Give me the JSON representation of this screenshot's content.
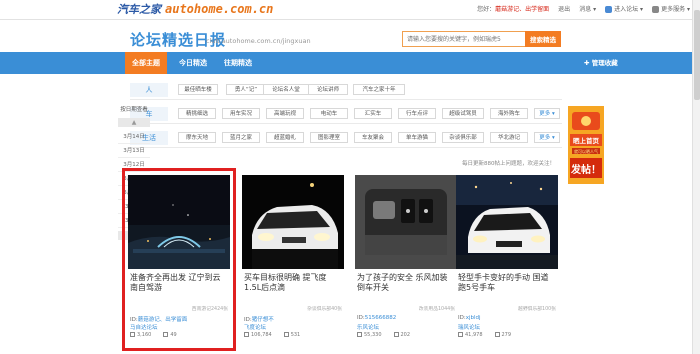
{
  "topbar": {
    "logo_cn": "汽车之家",
    "logo_domain": "autohome.com.cn",
    "greeting": "您好：",
    "user": "蘑菇游记、出学留面",
    "logout": "退出",
    "messages": "消息",
    "enter_forum": "进入论坛",
    "more_apps": "更多服务"
  },
  "header": {
    "title": "论坛精选日报",
    "subtitle": "club.autohome.com.cn/jingxuan",
    "search_placeholder": "请输入您要搜的关键字，例如瑞虎5",
    "search_button": "搜索精选"
  },
  "nav": {
    "tabs": [
      "全部主题",
      "今日精选",
      "往期精选"
    ],
    "active_index": 0,
    "favorites": "管理收藏"
  },
  "categories": [
    {
      "name": "人",
      "tags": [
        "最佳晒车楼",
        "勇人“记”",
        "论坛名人堂",
        "论坛讲师",
        "汽车之家十年"
      ]
    },
    {
      "name": "车",
      "tags": [
        "精挑细选",
        "用车实况",
        "高端玩视",
        "电动车",
        "汇实车",
        "行车点评",
        "超级试驾员",
        "海外购车",
        "更多"
      ]
    },
    {
      "name": "生活",
      "tags": [
        "摩东天地",
        "蓝月之家",
        "超蓝婚礼",
        "图影理室",
        "车友聚会",
        "单车游猫",
        "杂谈俱乐部",
        "华北游记",
        "更多"
      ]
    }
  ],
  "dates": {
    "header": "按日期查看",
    "items": [
      "3月14日",
      "3月13日",
      "3月12日",
      "3月11日",
      "3月10日",
      "3月9日",
      "3月8日"
    ]
  },
  "notice": "每日更新880帖上问题题，欢迎关注！",
  "cards": [
    {
      "title": "准备齐全再出发 辽宁到云南自驾游",
      "category": "西南游记2424张",
      "user_id": "蘑菇游记、出学留面",
      "forum": "马自达论坛",
      "views": "3,160",
      "replies": "49"
    },
    {
      "title": "买车目标很明确 提飞度1.5L后点滴",
      "category": "杂谈俱乐部40张",
      "user_id": "猪仔想不",
      "forum": "飞度论坛",
      "views": "106,784",
      "replies": "531"
    },
    {
      "title": "为了孩子的安全 乐风加装倒车开关",
      "category": "改装用品1044张",
      "user_id": "515666882",
      "forum": "乐风论坛",
      "views": "55,330",
      "replies": "202"
    },
    {
      "title": "轻型手卡变好的手动 国道跑5号手车",
      "category": "越野俱乐部100张",
      "user_id": "xjbldj",
      "forum": "瑞风论坛",
      "views": "41,978",
      "replies": "279"
    }
  ],
  "ad": {
    "line1": "晒上首页",
    "line2": "就可以晒人气",
    "big": "发帖！"
  },
  "colors": {
    "brand_blue": "#3a8ed6",
    "accent_orange": "#f37c22",
    "highlight_red": "#e02020"
  }
}
